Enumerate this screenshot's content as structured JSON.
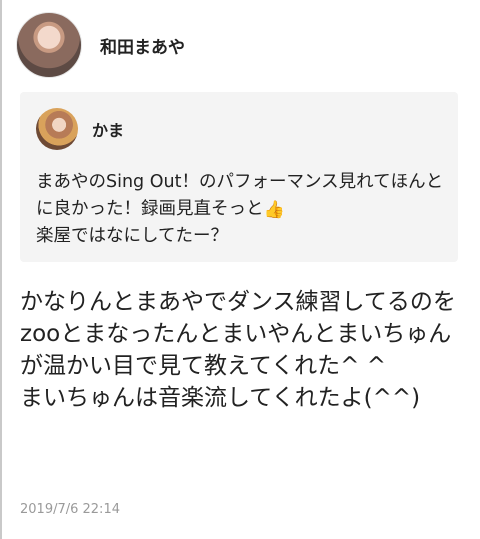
{
  "post": {
    "author": {
      "name": "和田まあや",
      "avatar_icon": "profile-photo"
    },
    "quote": {
      "author": {
        "name": "かま",
        "avatar_icon": "profile-photo"
      },
      "text_before_emoji": "まあやのSing Out！のパフォーマンス見れてほんとに良かった！録画見直そっと",
      "emoji": "👍",
      "text_after_emoji": "楽屋ではなにしてたー？"
    },
    "body": "かなりんとまあやでダンス練習してるのをzooとまなったんとまいやんとまいちゅんが温かい目で見て教えてくれた^ ^\nまいちゅんは音楽流してくれたよ(^^)",
    "timestamp": "2019/7/6 22:14"
  }
}
